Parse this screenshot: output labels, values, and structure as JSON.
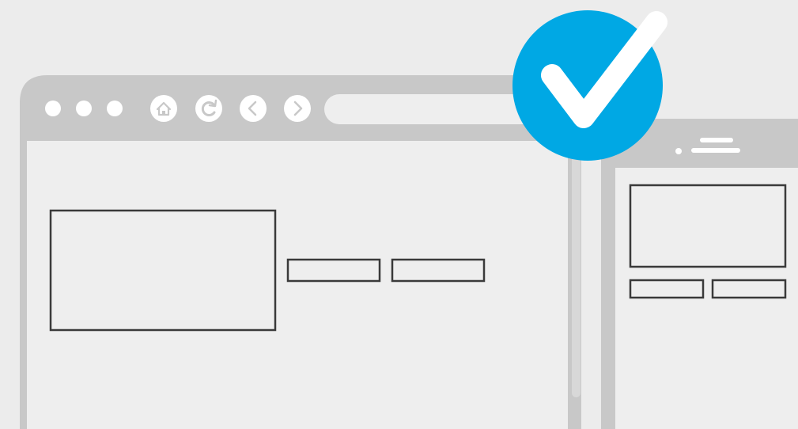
{
  "colors": {
    "background": "#ececec",
    "frame": "#c8c8c8",
    "screen": "#eeeeee",
    "outline": "#3a3a3a",
    "accent": "#00a8e4",
    "white": "#ffffff"
  },
  "browser": {
    "window_dots": [
      "window-dot",
      "window-dot",
      "window-dot"
    ],
    "toolbar_icons": [
      "home-icon",
      "reload-icon",
      "back-icon",
      "forward-icon"
    ],
    "address_bar": "url-bar"
  },
  "badge": {
    "icon": "checkmark-icon"
  },
  "phone": {
    "speaker": "speaker-icon"
  }
}
